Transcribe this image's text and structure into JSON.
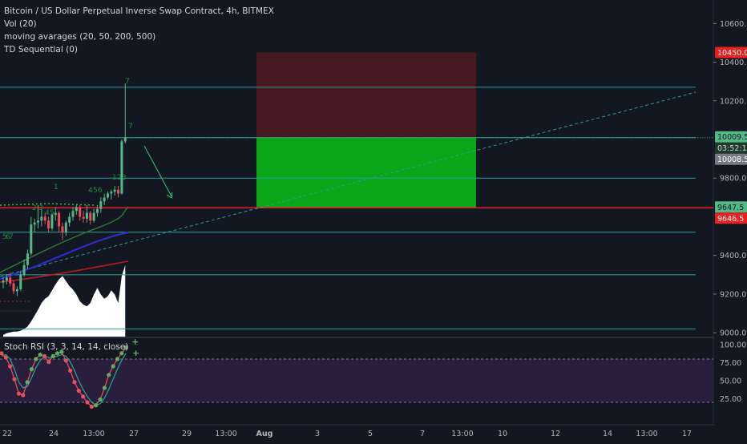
{
  "legend": {
    "title": "Bitcoin / US Dollar Perpetual Inverse Swap Contract, 4h, BITMEX",
    "study_vol": "Vol (20)",
    "study_ma": "moving avarages (20, 50, 200, 500)",
    "study_td": "TD Sequential (0)",
    "study_stoch": "Stoch RSI (3, 3, 14, 14, close)"
  },
  "colors": {
    "background": "#131722",
    "up": "#53b987",
    "down": "#eb4d5c",
    "level_line": "#2a9d9a",
    "support_line": "#e91e1e",
    "target_zone": "#09a617",
    "stop_zone": "#4a1a22",
    "volume": "#ffffff",
    "stoch_band": "#2a1e3d"
  },
  "price_axis": {
    "ticks": [
      "10600.0",
      "10400.0",
      "10200.0",
      "9800.0",
      "9400.0",
      "9200.0",
      "9000.0"
    ],
    "ylim": [
      8980,
      10680
    ],
    "labels": {
      "stop": "10450.0",
      "last_price": "10009.5",
      "countdown": "03:52:14",
      "prev_close": "10008.5",
      "ma_value": "9647.5",
      "entry": "9646.5"
    }
  },
  "stoch_axis": {
    "ticks": [
      "100.00",
      "75.00",
      "50.00",
      "25.00"
    ]
  },
  "time_axis": {
    "ticks": [
      "22",
      "24",
      "13:00",
      "27",
      "29",
      "13:00",
      "Aug",
      "3",
      "5",
      "7",
      "13:00",
      "10",
      "12",
      "14",
      "13:00",
      "17"
    ]
  },
  "chart_data": {
    "type": "candlestick",
    "symbol": "XBTUSD",
    "timeframe": "4h",
    "exchange": "BITMEX",
    "candles": [
      {
        "o": 9260,
        "h": 9290,
        "l": 9230,
        "c": 9270
      },
      {
        "o": 9270,
        "h": 9300,
        "l": 9250,
        "c": 9285
      },
      {
        "o": 9285,
        "h": 9310,
        "l": 9240,
        "c": 9255
      },
      {
        "o": 9255,
        "h": 9270,
        "l": 9200,
        "c": 9215
      },
      {
        "o": 9215,
        "h": 9240,
        "l": 9190,
        "c": 9225
      },
      {
        "o": 9225,
        "h": 9320,
        "l": 9215,
        "c": 9300
      },
      {
        "o": 9300,
        "h": 9380,
        "l": 9290,
        "c": 9350
      },
      {
        "o": 9350,
        "h": 9430,
        "l": 9330,
        "c": 9410
      },
      {
        "o": 9410,
        "h": 9600,
        "l": 9400,
        "c": 9560
      },
      {
        "o": 9560,
        "h": 9590,
        "l": 9520,
        "c": 9570
      },
      {
        "o": 9570,
        "h": 9660,
        "l": 9540,
        "c": 9580
      },
      {
        "o": 9580,
        "h": 9640,
        "l": 9550,
        "c": 9600
      },
      {
        "o": 9600,
        "h": 9620,
        "l": 9560,
        "c": 9580
      },
      {
        "o": 9580,
        "h": 9600,
        "l": 9520,
        "c": 9540
      },
      {
        "o": 9540,
        "h": 9620,
        "l": 9530,
        "c": 9610
      },
      {
        "o": 9610,
        "h": 9650,
        "l": 9580,
        "c": 9620
      },
      {
        "o": 9620,
        "h": 9630,
        "l": 9520,
        "c": 9550
      },
      {
        "o": 9550,
        "h": 9570,
        "l": 9480,
        "c": 9520
      },
      {
        "o": 9520,
        "h": 9580,
        "l": 9500,
        "c": 9570
      },
      {
        "o": 9570,
        "h": 9620,
        "l": 9550,
        "c": 9600
      },
      {
        "o": 9600,
        "h": 9650,
        "l": 9580,
        "c": 9630
      },
      {
        "o": 9630,
        "h": 9660,
        "l": 9610,
        "c": 9650
      },
      {
        "o": 9650,
        "h": 9660,
        "l": 9580,
        "c": 9600
      },
      {
        "o": 9600,
        "h": 9630,
        "l": 9570,
        "c": 9590
      },
      {
        "o": 9590,
        "h": 9660,
        "l": 9570,
        "c": 9620
      },
      {
        "o": 9620,
        "h": 9630,
        "l": 9560,
        "c": 9580
      },
      {
        "o": 9580,
        "h": 9640,
        "l": 9570,
        "c": 9620
      },
      {
        "o": 9620,
        "h": 9660,
        "l": 9600,
        "c": 9640
      },
      {
        "o": 9640,
        "h": 9700,
        "l": 9620,
        "c": 9680
      },
      {
        "o": 9680,
        "h": 9720,
        "l": 9660,
        "c": 9700
      },
      {
        "o": 9700,
        "h": 9730,
        "l": 9690,
        "c": 9720
      },
      {
        "o": 9720,
        "h": 9740,
        "l": 9690,
        "c": 9730
      },
      {
        "o": 9730,
        "h": 9760,
        "l": 9710,
        "c": 9740
      },
      {
        "o": 9740,
        "h": 9760,
        "l": 9700,
        "c": 9720
      },
      {
        "o": 9720,
        "h": 10000,
        "l": 9715,
        "c": 9990
      },
      {
        "o": 9990,
        "h": 10290,
        "l": 9980,
        "c": 10009.5
      }
    ],
    "volume_profile": [
      0.02,
      0.04,
      0.05,
      0.06,
      0.06,
      0.07,
      0.09,
      0.12,
      0.18,
      0.25,
      0.32,
      0.4,
      0.45,
      0.48,
      0.55,
      0.62,
      0.68,
      0.72,
      0.66,
      0.6,
      0.56,
      0.5,
      0.42,
      0.38,
      0.36,
      0.4,
      0.5,
      0.58,
      0.5,
      0.45,
      0.48,
      0.55,
      0.5,
      0.4,
      0.72,
      0.85
    ],
    "horizontal_levels": [
      10270,
      10009.5,
      9800,
      9520,
      9300,
      9020
    ],
    "support_level": 9646.5,
    "position": {
      "entry": 9646.5,
      "target": 10009.5,
      "stop": 10450.0
    },
    "stoch_rsi": {
      "k": [
        88,
        82,
        70,
        52,
        32,
        30,
        48,
        66,
        80,
        86,
        84,
        76,
        84,
        88,
        90,
        78,
        64,
        48,
        36,
        28,
        20,
        14,
        16,
        24,
        40,
        58,
        70,
        80,
        88,
        96
      ],
      "d": [
        84,
        86,
        80,
        66,
        48,
        40,
        42,
        54,
        68,
        78,
        84,
        82,
        82,
        84,
        86,
        84,
        76,
        64,
        50,
        38,
        28,
        20,
        16,
        18,
        26,
        38,
        52,
        66,
        78,
        88
      ],
      "upper_band": 80,
      "lower_band": 20
    },
    "td_counts": [
      "5",
      "6",
      "7",
      "1",
      "2",
      "3",
      "4",
      "5",
      "1",
      "2",
      "3",
      "4",
      "5",
      "6",
      "7"
    ]
  }
}
